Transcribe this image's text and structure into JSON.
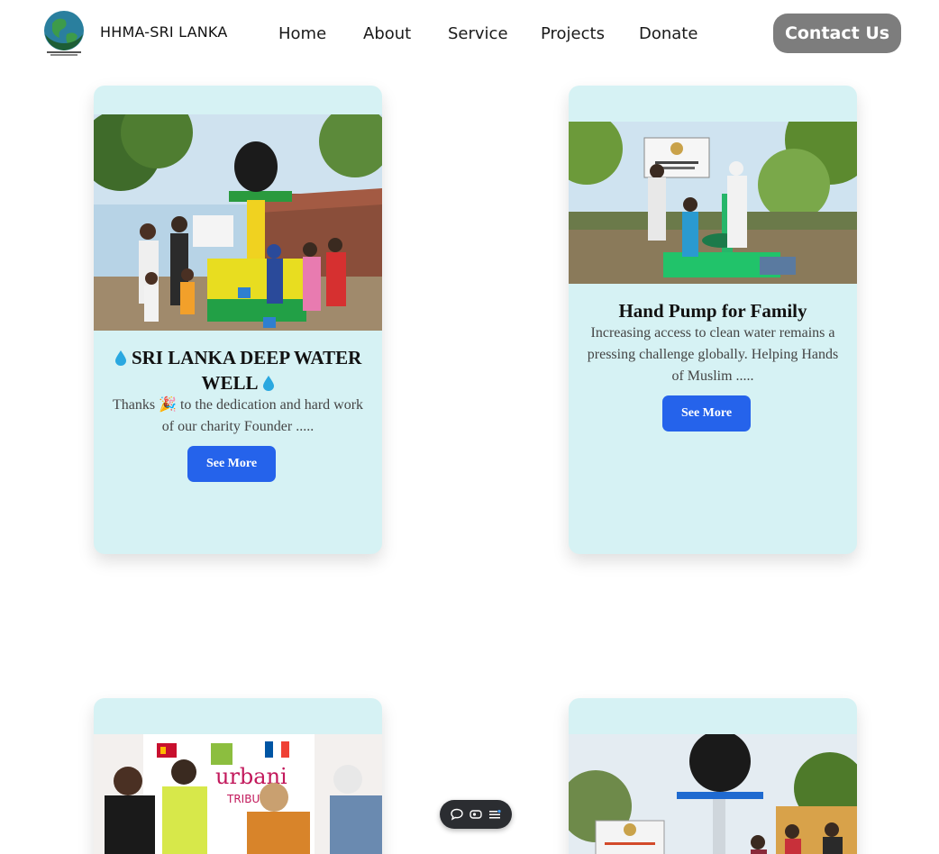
{
  "header": {
    "brand": "HHMA-SRI LANKA",
    "nav": [
      "Home",
      "About",
      "Service",
      "Projects",
      "Donate"
    ],
    "contact_label": "Contact Us"
  },
  "cards": [
    {
      "title": "SRI LANKA DEEP WATER WELL",
      "desc": "Thanks 🎉 to the dedication and hard work of our charity Founder .....",
      "button": "See More"
    },
    {
      "title": "Hand Pump for Family",
      "desc": "Increasing access to clean water remains a pressing challenge globally. Helping Hands of Muslim .....",
      "button": "See More"
    },
    {
      "photo_text": "urbani",
      "photo_sub": "TRIBUT"
    },
    {}
  ],
  "colors": {
    "card_bg": "#d6f2f4",
    "button_blue": "#2563eb",
    "contact_bg": "#7d7d7d"
  }
}
